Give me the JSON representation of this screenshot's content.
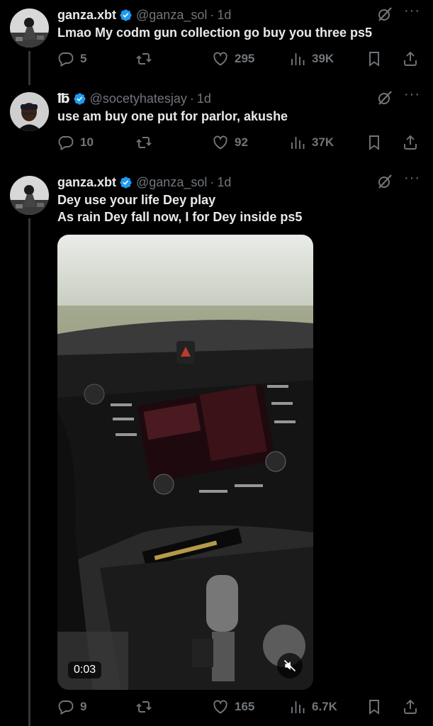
{
  "tweets": [
    {
      "name": "ganza.xbt",
      "handle": "@ganza_sol",
      "time": "1d",
      "text": "Lmao My codm gun collection go buy you three ps5",
      "replies": "5",
      "likes": "295",
      "views": "39K"
    },
    {
      "name": "℔",
      "handle": "@socetyhatesjay",
      "time": "1d",
      "text": "use am buy one put for parlor, akushe",
      "replies": "10",
      "likes": "92",
      "views": "37K"
    },
    {
      "name": "ganza.xbt",
      "handle": "@ganza_sol",
      "time": "1d",
      "text_line1": "Dey use your life Dey play",
      "text_line2": "As rain Dey fall now, I for Dey inside ps5",
      "video_duration": "0:03",
      "replies": "9",
      "likes": "165",
      "views": "6.7K"
    }
  ],
  "dot": "·",
  "colors": {
    "accent": "#1d9bf0",
    "muted": "#71767b",
    "text": "#e7e9ea",
    "background": "#000000"
  },
  "icons": [
    "verified-badge-icon",
    "grok-icon",
    "more-icon",
    "reply-icon",
    "retweet-icon",
    "like-icon",
    "views-icon",
    "bookmark-icon",
    "share-icon",
    "mute-icon"
  ]
}
